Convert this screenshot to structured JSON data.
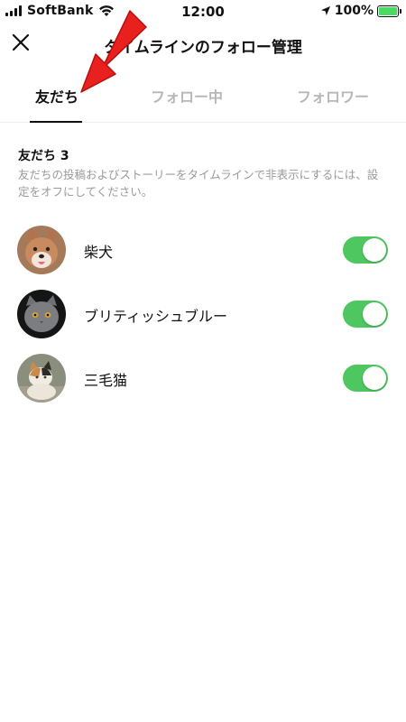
{
  "status_bar": {
    "carrier": "SoftBank",
    "time": "12:00",
    "battery_percent": "100%",
    "battery_level": 1.0,
    "battery_color": "#4cd964"
  },
  "header": {
    "close_icon": "close-icon",
    "title": "タイムラインのフォロー管理"
  },
  "tabs": [
    {
      "label": "友だち",
      "active": true
    },
    {
      "label": "フォロー中",
      "active": false
    },
    {
      "label": "フォロワー",
      "active": false
    }
  ],
  "friends_section": {
    "heading": "友だち 3",
    "description": "友だちの投稿およびストーリーをタイムラインで非表示にするには、設定をオフにしてください。"
  },
  "friends": [
    {
      "name": "柴犬",
      "follow_on": true
    },
    {
      "name": "ブリティッシュブルー",
      "follow_on": true
    },
    {
      "name": "三毛猫",
      "follow_on": true
    }
  ],
  "colors": {
    "toggle_on": "#4fc760",
    "tab_inactive": "#b7b7b7",
    "annotation_arrow": "#e8201e"
  }
}
